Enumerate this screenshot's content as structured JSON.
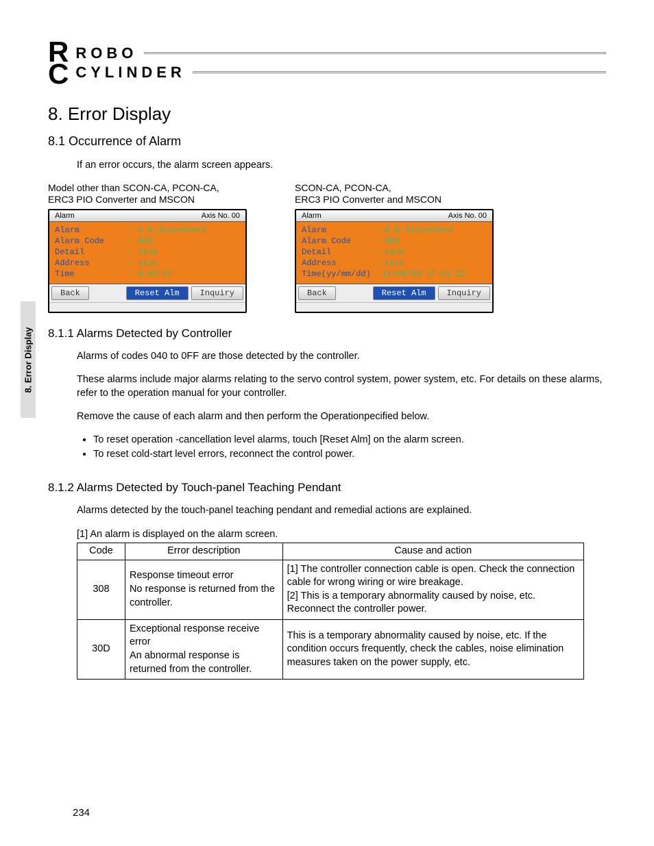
{
  "side_tab": "8. Error Display",
  "logo": {
    "initials_1": "R",
    "initials_2": "C",
    "word_1": "ROBO",
    "word_2": "CYLINDER"
  },
  "h1": "8.  Error Display",
  "s1": {
    "heading": "8.1      Occurrence of Alarm",
    "intro": "If an error occurs, the alarm screen appears.",
    "left_label": "Model other than SCON-CA, PCON-CA,\nERC3 PIO Converter and MSCON",
    "right_label": "SCON-CA, PCON-CA,\nERC3 PIO Converter and MSCON",
    "screen_left": {
      "title": "Alarm",
      "axis": "Axis No. 00",
      "rows": [
        {
          "k": "Alarm",
          "v": "A.B disconnect"
        },
        {
          "k": "Alarm Code",
          "v": "0E8"
        },
        {
          "k": "Detail",
          "v": "xxxx"
        },
        {
          "k": "Address",
          "v": "xxxx"
        },
        {
          "k": "Time",
          "v": " 0:03:27"
        }
      ],
      "btn_back": "Back",
      "btn_reset": "Reset Alm",
      "btn_inquiry": "Inquiry"
    },
    "screen_right": {
      "title": "Alarm",
      "axis": "Axis No. 00",
      "rows": [
        {
          "k": "Alarm",
          "v": "A.B disconnect"
        },
        {
          "k": "Alarm Code",
          "v": "0E8"
        },
        {
          "k": "Detail",
          "v": "xxxx"
        },
        {
          "k": "Address",
          "v": "xxxx"
        },
        {
          "k": "Time(yy/mm/dd)",
          "v": "11/08/03 17:21:22"
        }
      ],
      "btn_back": "Back",
      "btn_reset": "Reset Alm",
      "btn_inquiry": "Inquiry"
    }
  },
  "s11": {
    "heading": "8.1.1     Alarms Detected by Controller",
    "p1": "Alarms of codes 040 to 0FF are those detected by the controller.",
    "p2": "These alarms include major alarms relating to the servo control system, power system, etc. For details on these alarms, refer to the operation manual for your controller.",
    "p3": "Remove the cause of each alarm and then perform the Operationpecified below.",
    "b1": "To reset operation -cancellation level alarms, touch [Reset Alm] on the alarm screen.",
    "b2": "To reset cold-start level errors, reconnect the control power."
  },
  "s12": {
    "heading": "8.1.2     Alarms Detected by Touch-panel Teaching Pendant",
    "p1": "Alarms detected by the touch-panel teaching pendant and remedial actions are explained.",
    "caption": "[1]   An alarm is displayed on the alarm screen.",
    "th_code": "Code",
    "th_desc": "Error description",
    "th_cause": "Cause and action",
    "rows": [
      {
        "code": "308",
        "desc": "Response timeout error\nNo response is returned from the controller.",
        "cause": "[1] The controller connection cable is open. Check the connection cable for wrong wiring or wire breakage.\n[2] This is a temporary abnormality caused by noise, etc. Reconnect the controller power."
      },
      {
        "code": "30D",
        "desc": "Exceptional response receive error\nAn abnormal response is returned from the controller.",
        "cause": "This is a temporary abnormality caused by noise, etc. If the condition occurs frequently, check the cables, noise elimination measures taken on the power supply, etc."
      }
    ]
  },
  "page_number": "234"
}
